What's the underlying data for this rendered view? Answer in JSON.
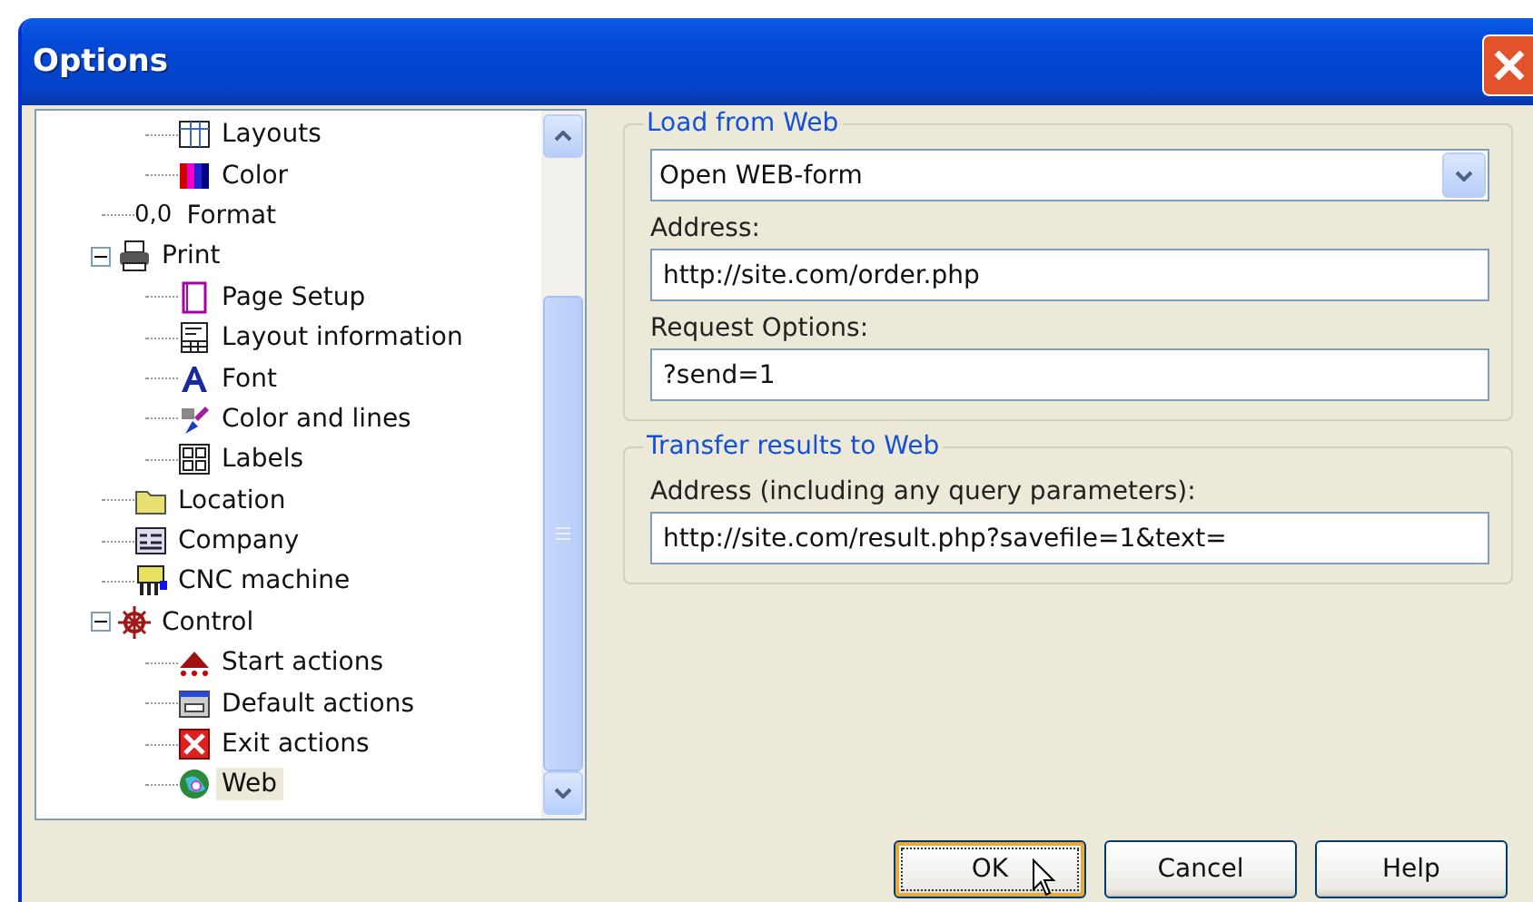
{
  "window": {
    "title": "Options"
  },
  "tree": {
    "continued_children": [
      {
        "label": "Layouts",
        "kind": "grid",
        "selected": false
      },
      {
        "label": "Color",
        "kind": "swatches",
        "selected": false
      }
    ],
    "items": [
      {
        "label": "Format",
        "kind": "numeric",
        "glyph": "0,0",
        "selected": false
      },
      {
        "label": "Print",
        "kind": "printer",
        "selected": false,
        "expanded": true,
        "children": [
          {
            "label": "Page Setup",
            "kind": "page",
            "selected": false
          },
          {
            "label": "Layout information",
            "kind": "sheet",
            "selected": false
          },
          {
            "label": "Font",
            "kind": "letter",
            "selected": false
          },
          {
            "label": "Color and lines",
            "kind": "paint",
            "selected": false
          },
          {
            "label": "Labels",
            "kind": "tiles",
            "selected": false
          }
        ]
      },
      {
        "label": "Location",
        "kind": "folder",
        "selected": false
      },
      {
        "label": "Company",
        "kind": "card",
        "selected": false
      },
      {
        "label": "CNC machine",
        "kind": "machine",
        "selected": false
      },
      {
        "label": "Control",
        "kind": "wheel",
        "selected": false,
        "expanded": true,
        "children": [
          {
            "label": "Start actions",
            "kind": "start",
            "selected": false
          },
          {
            "label": "Default actions",
            "kind": "tray",
            "selected": false
          },
          {
            "label": "Exit actions",
            "kind": "exit",
            "selected": false
          },
          {
            "label": "Web",
            "kind": "globe",
            "selected": true
          }
        ]
      }
    ]
  },
  "load_group": {
    "title": "Load from Web",
    "mode": "Open WEB-form",
    "address_label": "Address:",
    "address": "http://site.com/order.php",
    "options_label": "Request Options:",
    "options": "?send=1"
  },
  "transfer_group": {
    "title": "Transfer results to Web",
    "address_label": "Address (including any query parameters):",
    "address": "http://site.com/result.php?savefile=1&text="
  },
  "buttons": [
    {
      "label": "OK",
      "default": true
    },
    {
      "label": "Cancel",
      "default": false
    },
    {
      "label": "Help",
      "default": false
    }
  ]
}
